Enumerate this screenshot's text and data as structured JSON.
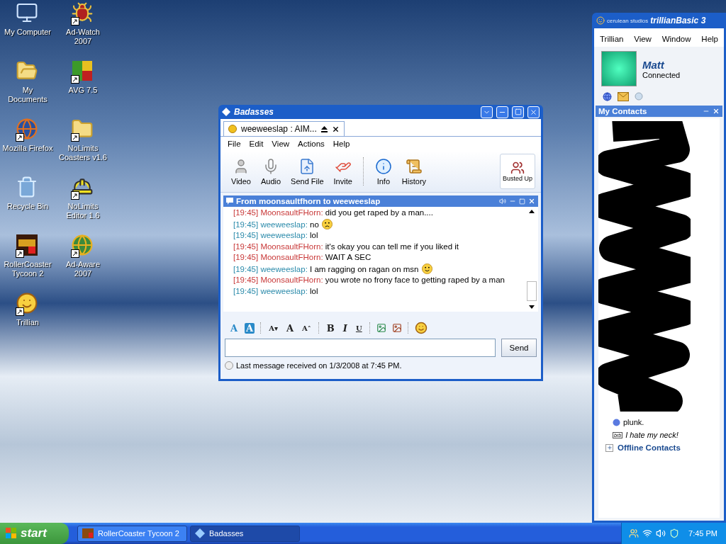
{
  "desktop_icons": [
    {
      "label": "My Computer",
      "kind": "computer",
      "shortcut": false
    },
    {
      "label": "Ad-Watch 2007",
      "kind": "bug",
      "shortcut": true
    },
    {
      "label": "My Documents",
      "kind": "documents",
      "shortcut": false
    },
    {
      "label": "AVG 7.5",
      "kind": "blocks",
      "shortcut": true
    },
    {
      "label": "Mozilla Firefox",
      "kind": "browser",
      "shortcut": true
    },
    {
      "label": "NoLimits Coasters v1.6",
      "kind": "folder",
      "shortcut": true
    },
    {
      "label": "Recycle Bin",
      "kind": "recycle",
      "shortcut": false
    },
    {
      "label": "NoLimits Editor 1.6",
      "kind": "hardhat",
      "shortcut": true
    },
    {
      "label": "RollerCoaster Tycoon 2",
      "kind": "game",
      "shortcut": true
    },
    {
      "label": "Ad-Aware 2007",
      "kind": "globe",
      "shortcut": true
    },
    {
      "label": "Trillian",
      "kind": "chat",
      "shortcut": true
    }
  ],
  "chat_window": {
    "title": "Badasses",
    "tabs": [
      {
        "label": "weeweeslap : AIM...",
        "selected": true
      }
    ],
    "menu": [
      "File",
      "Edit",
      "View",
      "Actions",
      "Help"
    ],
    "toolbar": [
      {
        "label": "Video",
        "kind": "video"
      },
      {
        "label": "Audio",
        "kind": "audio"
      },
      {
        "label": "Send File",
        "kind": "file"
      },
      {
        "label": "Invite",
        "kind": "invite"
      },
      {
        "label": "Info",
        "kind": "info"
      },
      {
        "label": "History",
        "kind": "history"
      }
    ],
    "side_button": "Busted Up",
    "pane_title": "From moonsaultfhorn to weeweeslap",
    "messages": [
      {
        "time": "[19:45]",
        "sender": "MoonsaultFHorn:",
        "text": "did you get raped by a man....",
        "kind": "remote"
      },
      {
        "time": "[19:45]",
        "sender": "weeweeslap:",
        "text": "no",
        "kind": "local",
        "emoticon": {
          "kind": "sad"
        }
      },
      {
        "time": "[19:45]",
        "sender": "weeweeslap:",
        "text": "lol",
        "kind": "local"
      },
      {
        "time": "[19:45]",
        "sender": "MoonsaultFHorn:",
        "text": "it's okay you can tell me if you liked it",
        "kind": "remote"
      },
      {
        "time": "[19:45]",
        "sender": "MoonsaultFHorn:",
        "text": "WAIT A SEC",
        "kind": "remote"
      },
      {
        "time": "[19:45]",
        "sender": "weeweeslap:",
        "text": "I am ragging on ragan on msn",
        "kind": "local",
        "emoticon": {
          "kind": "smile"
        }
      },
      {
        "time": "[19:45]",
        "sender": "MoonsaultFHorn:",
        "text": "you wrote no frony face to getting raped by a man",
        "kind": "remote"
      },
      {
        "time": "[19:45]",
        "sender": "weeweeslap:",
        "text": "lol",
        "kind": "local"
      }
    ],
    "format_buttons": [
      {
        "label": "A",
        "kind": "color"
      },
      {
        "label": "A",
        "kind": "highlight"
      },
      {
        "label": "A▾",
        "kind": "size"
      },
      {
        "label": "A",
        "kind": "plain"
      },
      {
        "label": "A˄",
        "kind": "size"
      },
      {
        "label": "B",
        "kind": "bold"
      },
      {
        "label": "I",
        "kind": "italic"
      },
      {
        "label": "U",
        "kind": "underline"
      }
    ],
    "send_button": "Send",
    "status": "Last message received on 1/3/2008 at 7:45 PM."
  },
  "trillian": {
    "logo_small": "cerulean studios",
    "logo": "trillianBasic",
    "logo_number": "3",
    "menu": [
      "Trillian",
      "View",
      "Window",
      "Help"
    ],
    "user": {
      "name": "Matt",
      "status": "Connected"
    },
    "contacts_title": "My Contacts",
    "contacts": [
      {
        "name": "plunk.",
        "kind": "online"
      },
      {
        "name": "I hate my neck!",
        "kind": "away",
        "badge": "brb"
      }
    ],
    "groups": [
      {
        "label": "Offline Contacts",
        "expanded": false
      }
    ]
  },
  "taskbar": {
    "start": "start",
    "tasks": [
      {
        "label": "RollerCoaster Tycoon 2",
        "selected": false
      },
      {
        "label": "Badasses",
        "selected": true
      }
    ],
    "clock": "7:45 PM"
  }
}
